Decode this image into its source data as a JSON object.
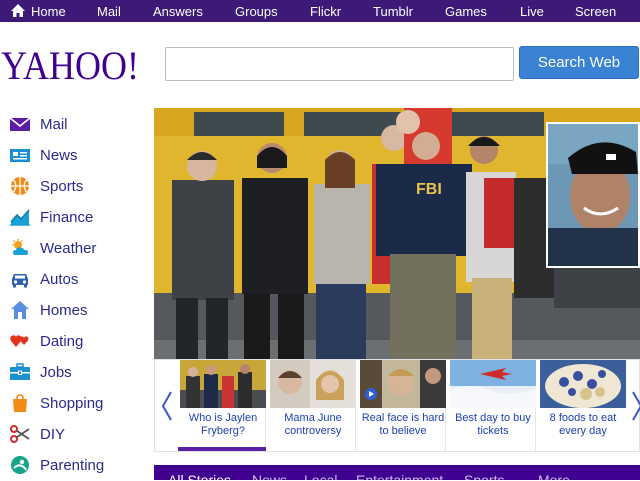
{
  "topnav": {
    "items": [
      "Home",
      "Mail",
      "Answers",
      "Groups",
      "Flickr",
      "Tumblr",
      "Games",
      "Live",
      "Screen"
    ]
  },
  "brand": {
    "logo_text": "YAHOO!",
    "color": "#400090"
  },
  "search": {
    "placeholder": "",
    "button_label": "Search Web"
  },
  "sidebar": {
    "items": [
      {
        "label": "Mail",
        "icon": "envelope-icon"
      },
      {
        "label": "News",
        "icon": "newspaper-icon"
      },
      {
        "label": "Sports",
        "icon": "basketball-icon"
      },
      {
        "label": "Finance",
        "icon": "chart-line-icon"
      },
      {
        "label": "Weather",
        "icon": "sun-cloud-icon"
      },
      {
        "label": "Autos",
        "icon": "car-icon"
      },
      {
        "label": "Homes",
        "icon": "house-icon"
      },
      {
        "label": "Dating",
        "icon": "hearts-icon"
      },
      {
        "label": "Jobs",
        "icon": "briefcase-icon"
      },
      {
        "label": "Shopping",
        "icon": "shopping-bag-icon"
      },
      {
        "label": "DIY",
        "icon": "scissors-icon"
      },
      {
        "label": "Parenting",
        "icon": "parenting-icon"
      }
    ]
  },
  "hero": {
    "badge_text": "FBI"
  },
  "carousel": {
    "items": [
      {
        "caption": "Who is Jaylen Fryberg?",
        "active": true
      },
      {
        "caption": "Mama June controversy",
        "active": false
      },
      {
        "caption": "Real face is hard to believe",
        "active": false
      },
      {
        "caption": "Best day to buy tickets",
        "active": false
      },
      {
        "caption": "8 foods to eat every day",
        "active": false
      }
    ]
  },
  "tabs": {
    "items": [
      "All Stories",
      "News",
      "Local",
      "Entertainment",
      "Sports",
      "More"
    ]
  }
}
